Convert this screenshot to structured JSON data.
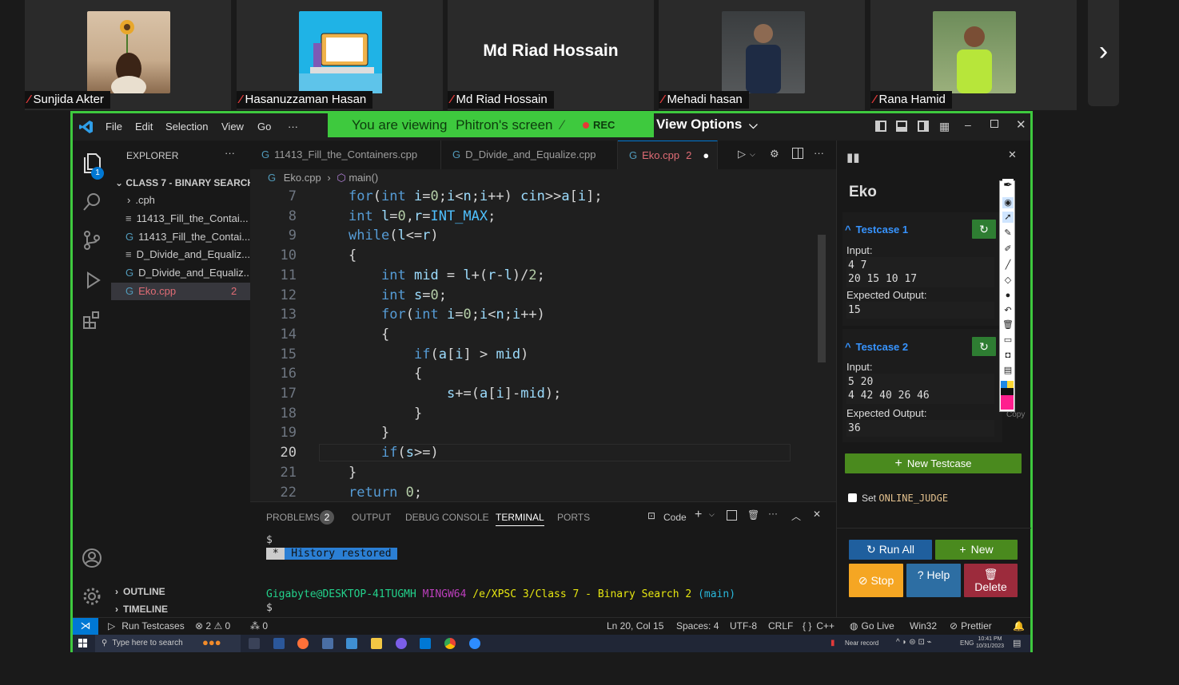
{
  "participants": [
    {
      "name": "Sunjida Akter",
      "kind": "photo"
    },
    {
      "name": "Hasanuzzaman Hasan",
      "kind": "photo"
    },
    {
      "name": "Md Riad Hossain",
      "kind": "name"
    },
    {
      "name": "Mehadi hasan",
      "kind": "photo"
    },
    {
      "name": "Rana Hamid",
      "kind": "photo"
    }
  ],
  "share": {
    "viewing_prefix": "You are viewing",
    "viewing_name": "Phitron's screen",
    "rec": "REC",
    "view_options": "View Options"
  },
  "vscode": {
    "menu": [
      "File",
      "Edit",
      "Selection",
      "View",
      "Go",
      "···"
    ],
    "explorer": {
      "title": "EXPLORER",
      "folder": "CLASS 7 - BINARY SEARCH 2",
      "items": [
        {
          "label": ".cph",
          "icon": "chevron-right-icon"
        },
        {
          "label": "11413_Fill_the_Contai...",
          "icon": "text-file-icon"
        },
        {
          "label": "11413_Fill_the_Contai...",
          "icon": "cpp-file-icon"
        },
        {
          "label": "D_Divide_and_Equaliz...",
          "icon": "text-file-icon"
        },
        {
          "label": "D_Divide_and_Equaliz...",
          "icon": "cpp-file-icon"
        },
        {
          "label": "Eko.cpp",
          "icon": "cpp-file-icon",
          "badge": "2",
          "active": true
        }
      ],
      "outline": "OUTLINE",
      "timeline": "TIMELINE",
      "badge": "1"
    },
    "tabs": [
      {
        "label": "11413_Fill_the_Containers.cpp"
      },
      {
        "label": "D_Divide_and_Equalize.cpp"
      },
      {
        "label": "Eko.cpp",
        "badge": "2",
        "active": true
      }
    ],
    "breadcrumb": {
      "file": "Eko.cpp",
      "symbol": "main()"
    },
    "code_lines": [
      {
        "n": "7",
        "text": "for(int i=0;i<n;i++) cin>>a[i];"
      },
      {
        "n": "8",
        "text": "int l=0,r=INT_MAX;"
      },
      {
        "n": "9",
        "text": "while(l<=r)"
      },
      {
        "n": "10",
        "text": "{"
      },
      {
        "n": "11",
        "text": "int mid = l+(r-l)/2;"
      },
      {
        "n": "12",
        "text": "int s=0;"
      },
      {
        "n": "13",
        "text": "for(int i=0;i<n;i++)"
      },
      {
        "n": "14",
        "text": "{"
      },
      {
        "n": "15",
        "text": "if(a[i] > mid)"
      },
      {
        "n": "16",
        "text": "{"
      },
      {
        "n": "17",
        "text": "s+=(a[i]-mid);"
      },
      {
        "n": "18",
        "text": "}"
      },
      {
        "n": "19",
        "text": "}"
      },
      {
        "n": "20",
        "text": "if(s>=)"
      },
      {
        "n": "21",
        "text": "}"
      },
      {
        "n": "22",
        "text": "return 0;"
      }
    ],
    "panel": {
      "tabs": [
        "PROBLEMS",
        "OUTPUT",
        "DEBUG CONSOLE",
        "TERMINAL",
        "PORTS"
      ],
      "problems_count": "2",
      "terminal_label": "Code",
      "terminal": {
        "prompt1": "$",
        "history_star": " * ",
        "history": " History restored ",
        "user": "Gigabyte@DESKTOP-41TUGMH",
        "shell": "MINGW64",
        "path": "/e/XPSC 3/Class 7 - Binary Search 2",
        "branch": "(main)",
        "prompt2": "$"
      }
    },
    "cph": {
      "title": "Eko",
      "testcases": [
        {
          "label": "Testcase 1",
          "input_label": "Input:",
          "input": "4 7\n20 15 10 17",
          "expected_label": "Expected Output:",
          "expected": "15"
        },
        {
          "label": "Testcase 2",
          "input_label": "Input:",
          "input": "5 20\n4 42 40 26 46",
          "expected_label": "Expected Output:",
          "expected": "36"
        }
      ],
      "copy": "Copy",
      "new_testcase": "New Testcase",
      "online_judge_prefix": "Set",
      "online_judge": "ONLINE_JUDGE",
      "run_all": "Run All",
      "new": "New",
      "stop": "Stop",
      "help": "Help",
      "delete": "Delete"
    },
    "status": {
      "run_testcases": "Run Testcases",
      "errors": "2",
      "warnings": "0",
      "ports": "0",
      "position": "Ln 20, Col 15",
      "spaces": "Spaces: 4",
      "encoding": "UTF-8",
      "eol": "CRLF",
      "language": "C++",
      "go_live": "Go Live",
      "platform": "Win32",
      "prettier": "Prettier"
    }
  },
  "taskbar": {
    "search": "Type here to search",
    "near_record": "Near record",
    "lang": "ENG",
    "time": "10:41 PM",
    "date": "10/31/2023"
  },
  "colors": {
    "share_green": "#3ec93e",
    "accent_blue": "#0078d4",
    "run_all": "#1f5f9e",
    "new_green": "#4a8a1e",
    "stop_orange": "#f5a623",
    "help_blue": "#2d6ea3",
    "delete_red": "#9c2b3c"
  }
}
